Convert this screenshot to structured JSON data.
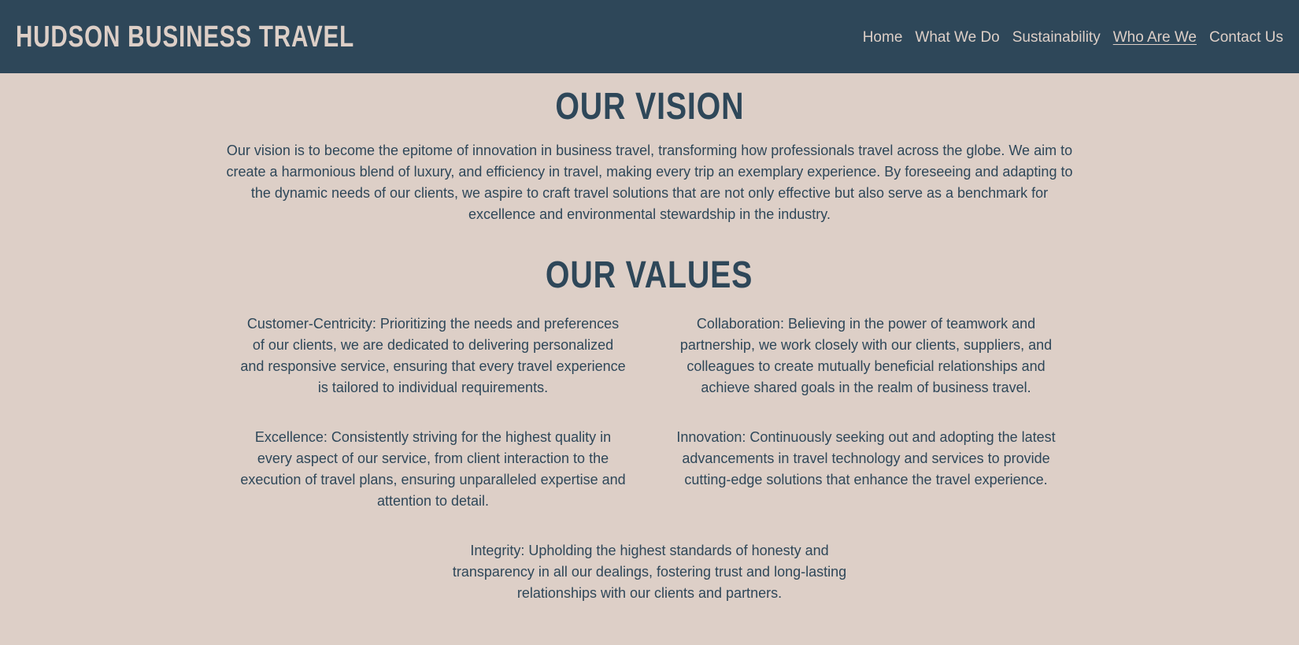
{
  "header": {
    "brand": "HUDSON BUSINESS TRAVEL",
    "nav": [
      {
        "label": "Home",
        "active": false
      },
      {
        "label": "What We Do",
        "active": false
      },
      {
        "label": "Sustainability",
        "active": false
      },
      {
        "label": "Who Are We",
        "active": true
      },
      {
        "label": "Contact Us",
        "active": false
      }
    ]
  },
  "vision": {
    "title": "OUR VISION",
    "text": "Our vision is to become the epitome of innovation in business travel, transforming how professionals travel across the globe. We aim to create a harmonious blend of luxury, and efficiency in travel, making every trip an exemplary experience. By foreseeing and adapting to the dynamic needs of our clients, we aspire to craft travel solutions that are not only effective but also serve as a benchmark for excellence and environmental stewardship in the industry."
  },
  "values": {
    "title": "OUR VALUES",
    "items": [
      "Customer-Centricity: Prioritizing the needs and preferences of our clients, we are dedicated to delivering personalized and responsive service, ensuring that every travel experience is tailored to individual requirements.",
      "Collaboration: Believing in the power of teamwork and partnership, we work closely with our clients, suppliers, and colleagues to create mutually beneficial relationships and achieve shared goals in the realm of business travel.",
      "Excellence: Consistently striving for the highest quality in every aspect of our service, from client interaction to the execution of travel plans, ensuring unparalleled expertise and attention to detail.",
      "Innovation: Continuously seeking out and adopting the latest advancements in travel technology and services to provide cutting-edge solutions that enhance the travel experience.",
      "Integrity: Upholding the highest standards of honesty and transparency in all our dealings, fostering trust and long-lasting relationships with our clients and partners."
    ]
  },
  "colors": {
    "header_bg": "#2e4759",
    "page_bg": "#ddcfc7",
    "text": "#2e4759",
    "header_text": "#ddcfc7"
  }
}
